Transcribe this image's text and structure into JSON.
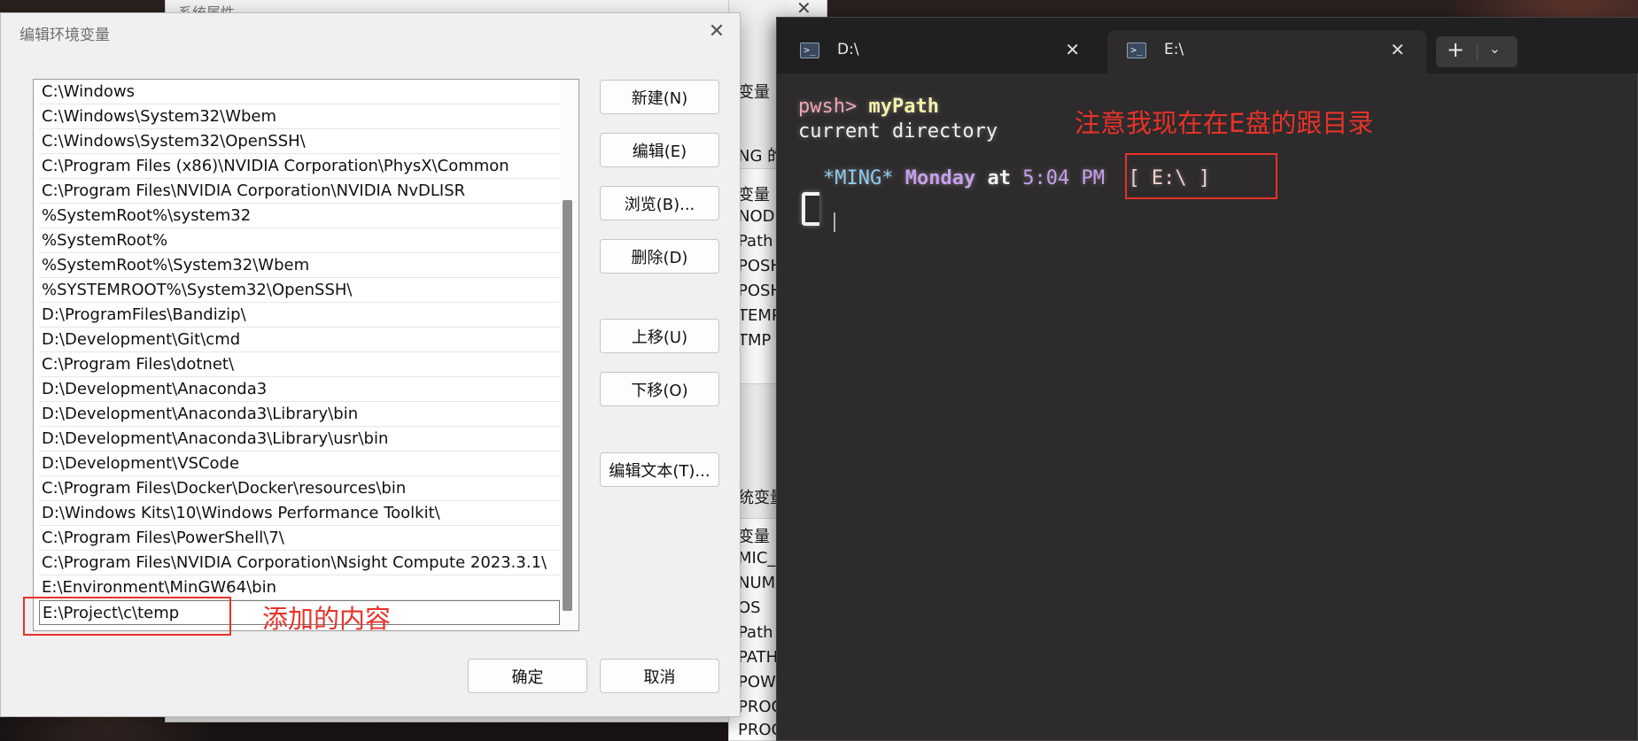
{
  "system_properties": {
    "title": "系统属性"
  },
  "env_vars_window": {
    "fragments": [
      "变量",
      "NG 的",
      "变量",
      "NOD",
      "Path",
      "POSH",
      "POSH",
      "TEMP",
      "TMP",
      "统变量",
      "变量",
      "MIC_",
      "NUM",
      "OS",
      "Path",
      "PATH",
      "POW",
      "PROC",
      "PROC"
    ]
  },
  "edit_dialog": {
    "title": "编辑环境变量",
    "paths": [
      "C:\\Windows",
      "C:\\Windows\\System32\\Wbem",
      "C:\\Windows\\System32\\OpenSSH\\",
      "C:\\Program Files (x86)\\NVIDIA Corporation\\PhysX\\Common",
      "C:\\Program Files\\NVIDIA Corporation\\NVIDIA NvDLISR",
      "%SystemRoot%\\system32",
      "%SystemRoot%",
      "%SystemRoot%\\System32\\Wbem",
      "%SYSTEMROOT%\\System32\\OpenSSH\\",
      "D:\\ProgramFiles\\Bandizip\\",
      "D:\\Development\\Git\\cmd",
      "C:\\Program Files\\dotnet\\",
      "D:\\Development\\Anaconda3",
      "D:\\Development\\Anaconda3\\Library\\bin",
      "D:\\Development\\Anaconda3\\Library\\usr\\bin",
      "D:\\Development\\VSCode",
      "C:\\Program Files\\Docker\\Docker\\resources\\bin",
      "D:\\Windows Kits\\10\\Windows Performance Toolkit\\",
      "C:\\Program Files\\PowerShell\\7\\",
      "C:\\Program Files\\NVIDIA Corporation\\Nsight Compute 2023.3.1\\",
      "E:\\Environment\\MinGW64\\bin",
      "E:\\Project\\c\\temp"
    ],
    "buttons": {
      "new": "新建(N)",
      "edit": "编辑(E)",
      "browse": "浏览(B)...",
      "delete": "删除(D)",
      "move_up": "上移(U)",
      "move_down": "下移(O)",
      "edit_text": "编辑文本(T)...",
      "ok": "确定",
      "cancel": "取消"
    }
  },
  "terminal": {
    "tabs": [
      {
        "title": "D:\\",
        "icon": "powershell-icon"
      },
      {
        "title": "E:\\",
        "icon": "powershell-icon"
      }
    ],
    "new_tab_label": "+",
    "dropdown_label": "⌄",
    "lines": {
      "prompt": "pwsh> ",
      "command": "myPath",
      "output": "current directory",
      "user": "*MING*",
      "day": "Monday",
      "at": "at",
      "time": "5:04 PM",
      "dir": "[ E:\\ ]"
    }
  },
  "annotations": {
    "terminal_note": "注意我现在在E盘的跟目录",
    "list_note": "添加的内容",
    "color": "#e8322a"
  }
}
